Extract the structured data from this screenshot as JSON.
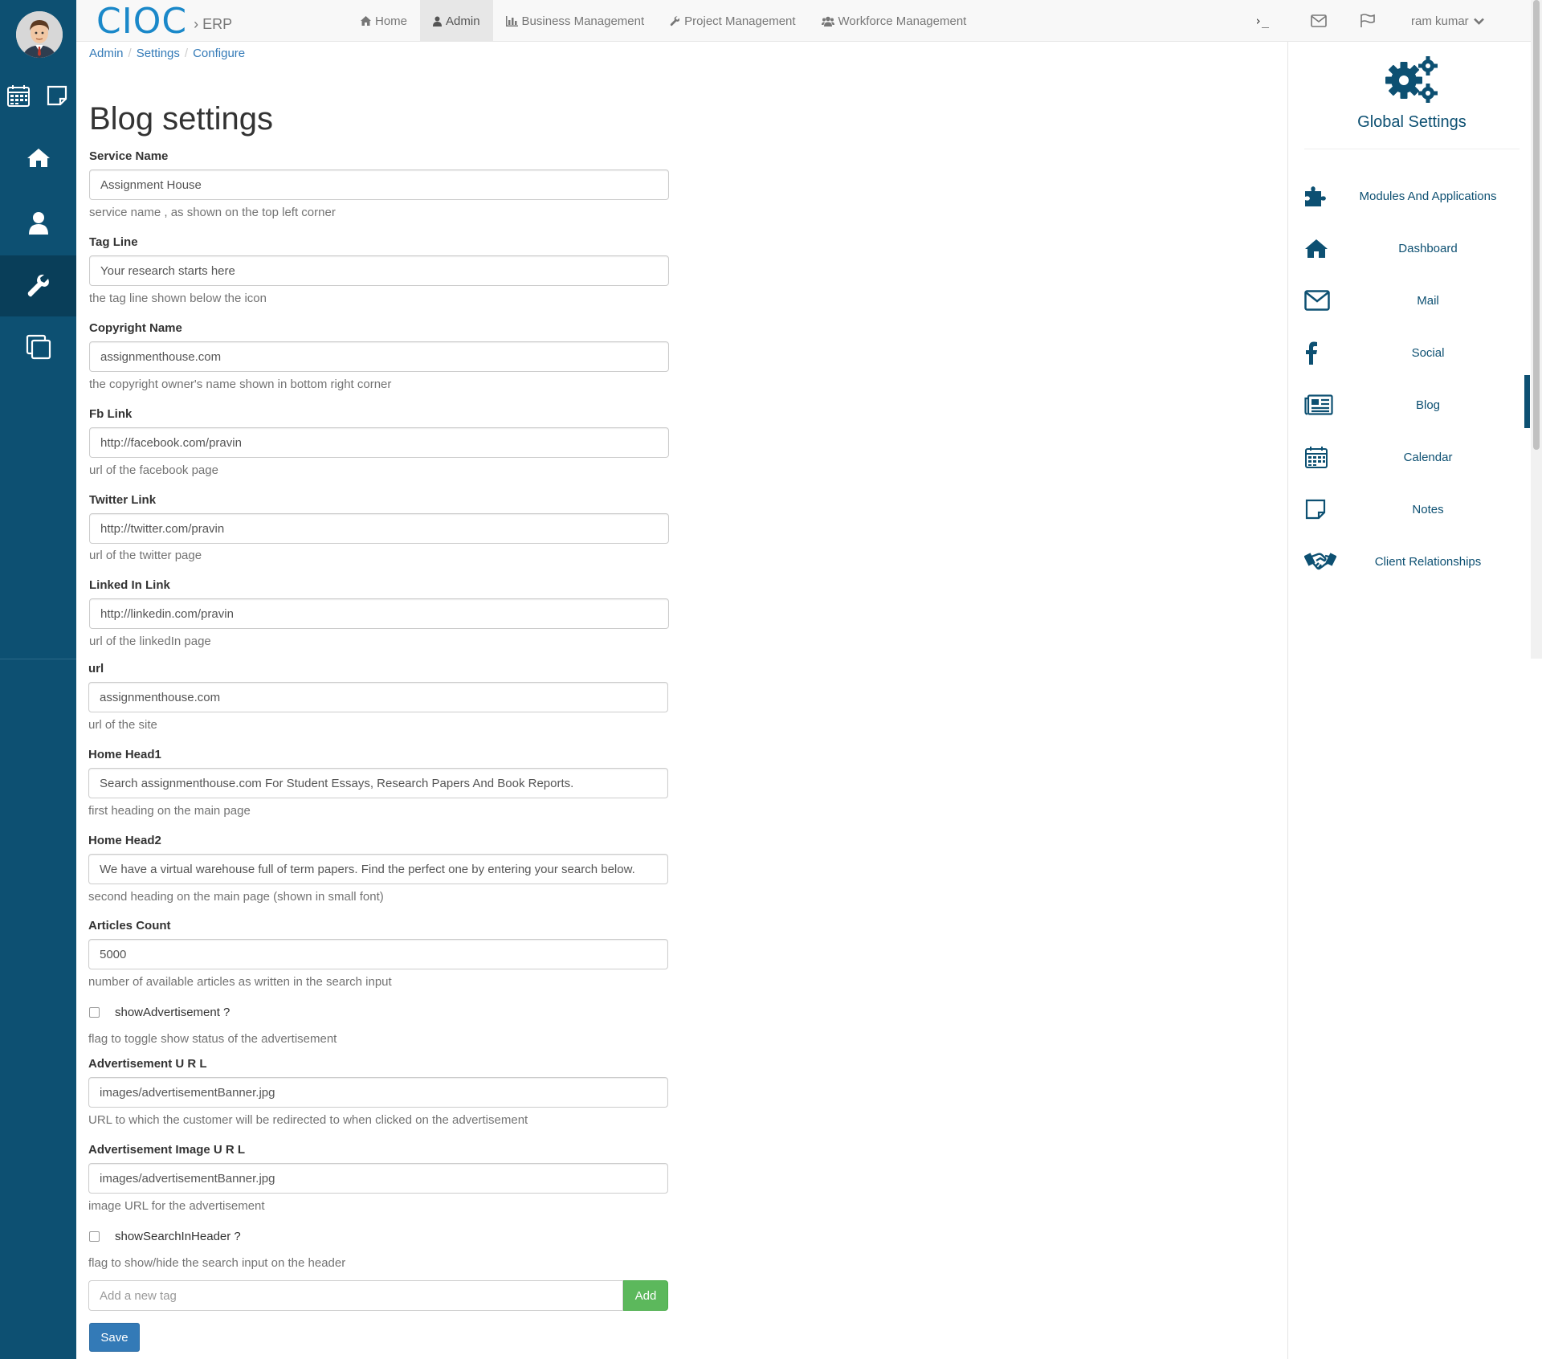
{
  "app": {
    "logo_text": "CIOC",
    "logo_separator": "›",
    "product": "ERP"
  },
  "nav": {
    "links": [
      {
        "label": "Home",
        "icon": "home-icon"
      },
      {
        "label": "Admin",
        "icon": "user-icon",
        "active": true
      },
      {
        "label": "Business Management",
        "icon": "bar-chart-icon"
      },
      {
        "label": "Project Management",
        "icon": "wrench-icon"
      },
      {
        "label": "Workforce Management",
        "icon": "users-icon"
      }
    ],
    "terminal_glyph": "›_",
    "user_name": "ram kumar"
  },
  "breadcrumb": [
    "Admin",
    "Settings",
    "Configure"
  ],
  "page": {
    "title": "Blog settings"
  },
  "fields": [
    {
      "label": "Service Name",
      "value": "Assignment House",
      "help": "service name , as shown on the top left corner"
    },
    {
      "label": "Tag Line",
      "value": "Your research starts here",
      "help": "the tag line shown below the icon"
    },
    {
      "label": "Copyright Name",
      "value": "assignmenthouse.com",
      "help": "the copyright owner's name shown in bottom right corner"
    },
    {
      "label": "Fb Link",
      "value": "http://facebook.com/pravin",
      "help": "url of the facebook page"
    },
    {
      "label": "Twitter Link",
      "value": "http://twitter.com/pravin",
      "help": "url of the twitter page"
    },
    {
      "label": "Linked In Link",
      "value": "http://linkedin.com/pravin",
      "help": "url of the linkedIn page"
    },
    {
      "label": "url",
      "value": "assignmenthouse.com",
      "help": "url of the site"
    },
    {
      "label": "Home Head1",
      "value": "Search assignmenthouse.com For Student Essays, Research Papers And Book Reports.",
      "help": "first heading on the main page"
    },
    {
      "label": "Home Head2",
      "value": "We have a virtual warehouse full of term papers. Find the perfect one by entering your search below.",
      "help": "second heading on the main page (shown in small font)"
    },
    {
      "label": "Articles Count",
      "value": "5000",
      "help": "number of available articles as written in the search input"
    }
  ],
  "checkbox_show_ad": {
    "label": "showAdvertisement ?",
    "checked": false,
    "help": "flag to toggle show status of the advertisement"
  },
  "fields_ad": [
    {
      "label": "Advertisement U R L",
      "value": "images/advertisementBanner.jpg",
      "help": "URL to which the customer will be redirected to when clicked on the advertisement"
    },
    {
      "label": "Advertisement Image U R L",
      "value": "images/advertisementBanner.jpg",
      "help": "image URL for the advertisement"
    }
  ],
  "checkbox_search": {
    "label": "showSearchInHeader ?",
    "checked": false,
    "help": "flag to show/hide the search input on the header"
  },
  "tags": {
    "placeholder": "Add a new tag",
    "add_label": "Add"
  },
  "save_label": "Save",
  "right_panel": {
    "title": "Global Settings",
    "items": [
      {
        "label": "Modules And Applications",
        "icon": "puzzle-icon"
      },
      {
        "label": "Dashboard",
        "icon": "home-icon"
      },
      {
        "label": "Mail",
        "icon": "envelope-icon"
      },
      {
        "label": "Social",
        "icon": "facebook-icon"
      },
      {
        "label": "Blog",
        "icon": "newspaper-icon",
        "active": true
      },
      {
        "label": "Calendar",
        "icon": "calendar-icon"
      },
      {
        "label": "Notes",
        "icon": "sticky-note-icon"
      },
      {
        "label": "Client Relationships",
        "icon": "handshake-icon"
      }
    ]
  },
  "colors": {
    "sidebar": "#0d5072",
    "brand": "#1a88c9",
    "link": "#337ab7",
    "add_button": "#5cb85c",
    "save_button": "#337ab7"
  }
}
